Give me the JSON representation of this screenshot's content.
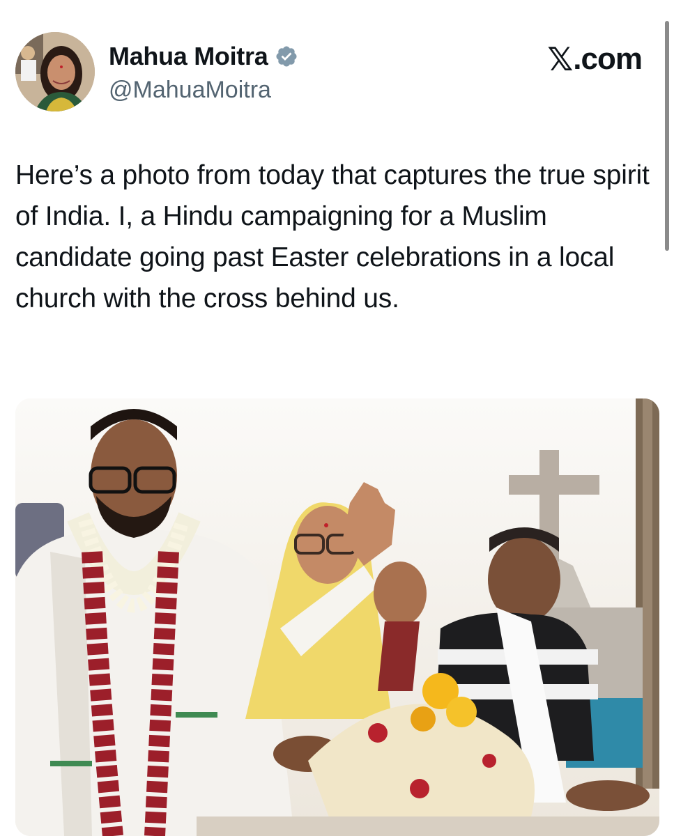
{
  "author": {
    "display_name": "Mahua Moitra",
    "handle": "@MahuaMoitra",
    "verified": true,
    "verified_color": "#829aab",
    "avatar_icon": "profile-photo"
  },
  "site": {
    "label": ".com",
    "logo_glyph": "𝕏"
  },
  "tweet": {
    "text": "Here’s a photo from today that captures the true spirit of India. I, a Hindu campaigning for a Muslim candidate going past Easter celebrations in a local church with the cross behind us."
  },
  "media": {
    "kind": "photo"
  },
  "colors": {
    "text": "#0f1419",
    "secondary_text": "#536471",
    "background": "#ffffff"
  }
}
